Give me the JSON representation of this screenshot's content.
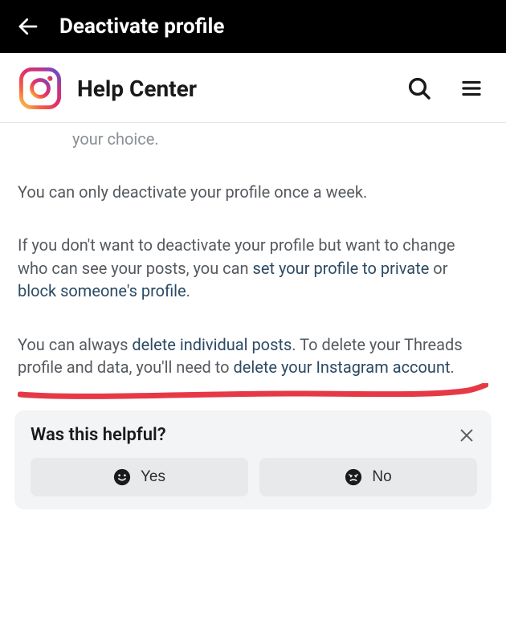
{
  "topbar": {
    "title": "Deactivate profile"
  },
  "subheader": {
    "title": "Help Center"
  },
  "content": {
    "truncated": "your choice.",
    "p1": "You can only deactivate your profile once a week.",
    "p2_a": "If you don't want to deactivate your profile but want to change who can see your posts, you can ",
    "p2_link1": "set your profile to private",
    "p2_b": " or ",
    "p2_link2": "block someone's profile",
    "p2_c": ".",
    "p3_a": "You can always ",
    "p3_link1": "delete individual posts",
    "p3_b": ". To delete your Threads profile and data, you'll need to ",
    "p3_link2": "delete your Instagram account",
    "p3_c": "."
  },
  "feedback": {
    "title": "Was this helpful?",
    "yes": "Yes",
    "no": "No"
  }
}
